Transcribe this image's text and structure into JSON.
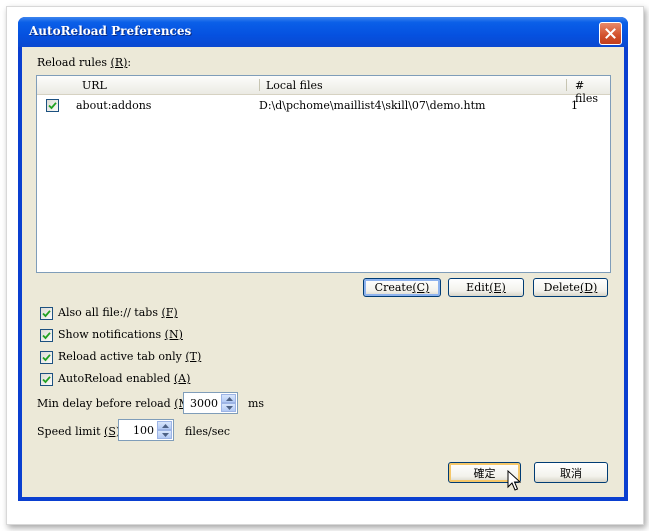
{
  "window": {
    "title": "AutoReload Preferences"
  },
  "rules": {
    "label": "Reload rules ",
    "label_key": "(R)",
    "label_suffix": ":",
    "columns": {
      "url": "URL",
      "local": "Local files",
      "count": "# files"
    },
    "rows": [
      {
        "checked": true,
        "url": "about:addons",
        "local": "D:\\d\\pchome\\maillist4\\skill\\07\\demo.htm",
        "count": "1"
      }
    ]
  },
  "buttons": {
    "create": {
      "label": "Create ",
      "key": "(C)"
    },
    "edit": {
      "label": "Edit ",
      "key": "(E)"
    },
    "delete": {
      "label": "Delete ",
      "key": "(D)"
    },
    "ok": "確定",
    "cancel": "取消"
  },
  "options": {
    "file_tabs": {
      "label": "Also all file:// tabs ",
      "key": "(F)",
      "checked": true
    },
    "notifications": {
      "label": "Show notifications ",
      "key": "(N)",
      "checked": true
    },
    "active_only": {
      "label": "Reload active tab only ",
      "key": "(T)",
      "checked": true
    },
    "enabled": {
      "label": "AutoReload enabled ",
      "key": "(A)",
      "checked": true
    }
  },
  "min_delay": {
    "label": "Min delay before reload ",
    "key": "(M)",
    "suffix": ":",
    "value": "3000",
    "unit": "ms"
  },
  "speed": {
    "label": "Speed limit ",
    "key": "(S)",
    "suffix": ":",
    "value": "100",
    "unit": "files/sec"
  },
  "colors": {
    "titlebar": "#0551e0",
    "client": "#ece9d8",
    "check": "#21a121"
  }
}
